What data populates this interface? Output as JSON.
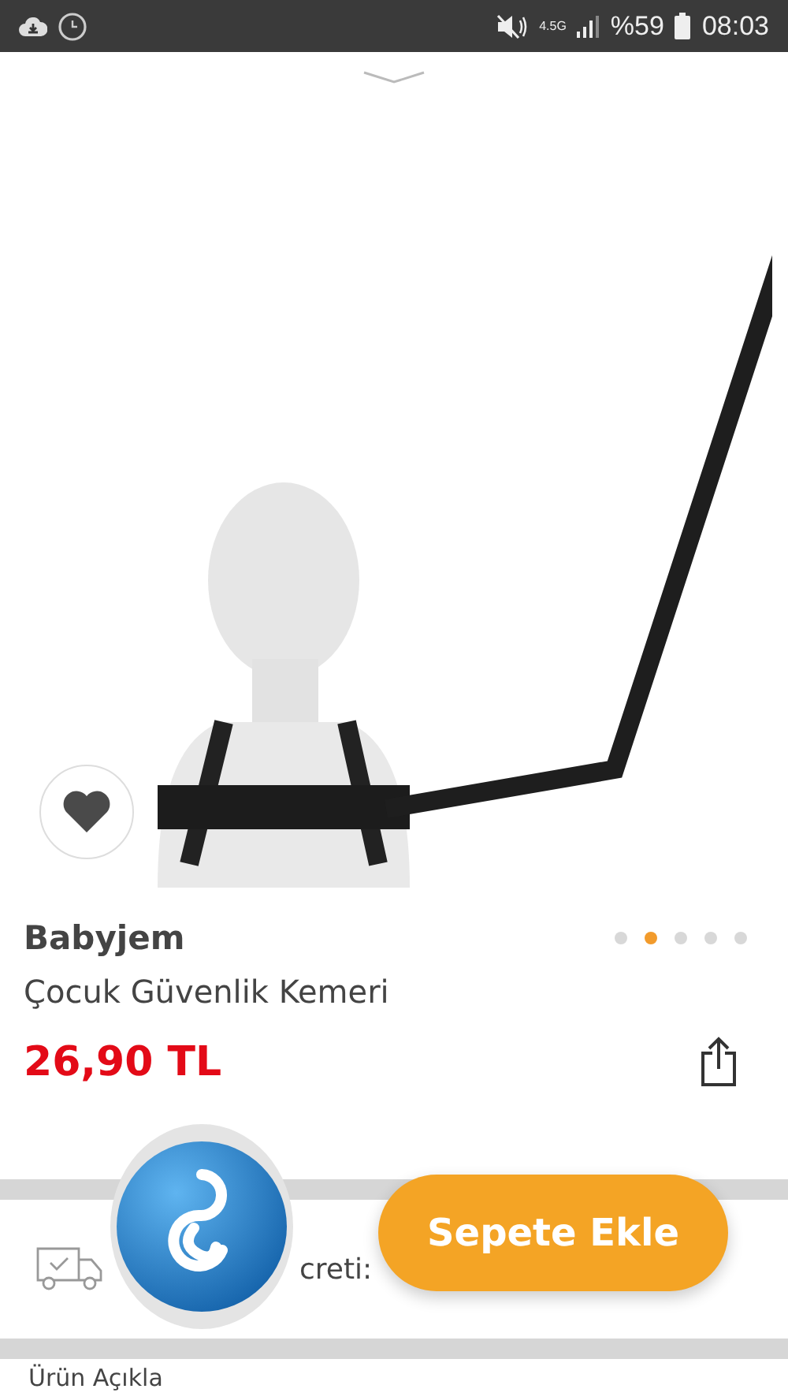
{
  "status_bar": {
    "network": "4.5G",
    "battery": "%59",
    "time": "08:03"
  },
  "gallery": {
    "favorite": false,
    "dots": [
      {
        "selected": false
      },
      {
        "selected": true
      },
      {
        "selected": false
      },
      {
        "selected": false
      },
      {
        "selected": false
      }
    ]
  },
  "product": {
    "brand": "Babyjem",
    "name": "Çocuk Güvenlik Kemeri",
    "price": "26,90 TL"
  },
  "shipping": {
    "label": "creti:"
  },
  "add_to_cart": "Sepete Ekle",
  "section_title": "Ürün Açıkla"
}
